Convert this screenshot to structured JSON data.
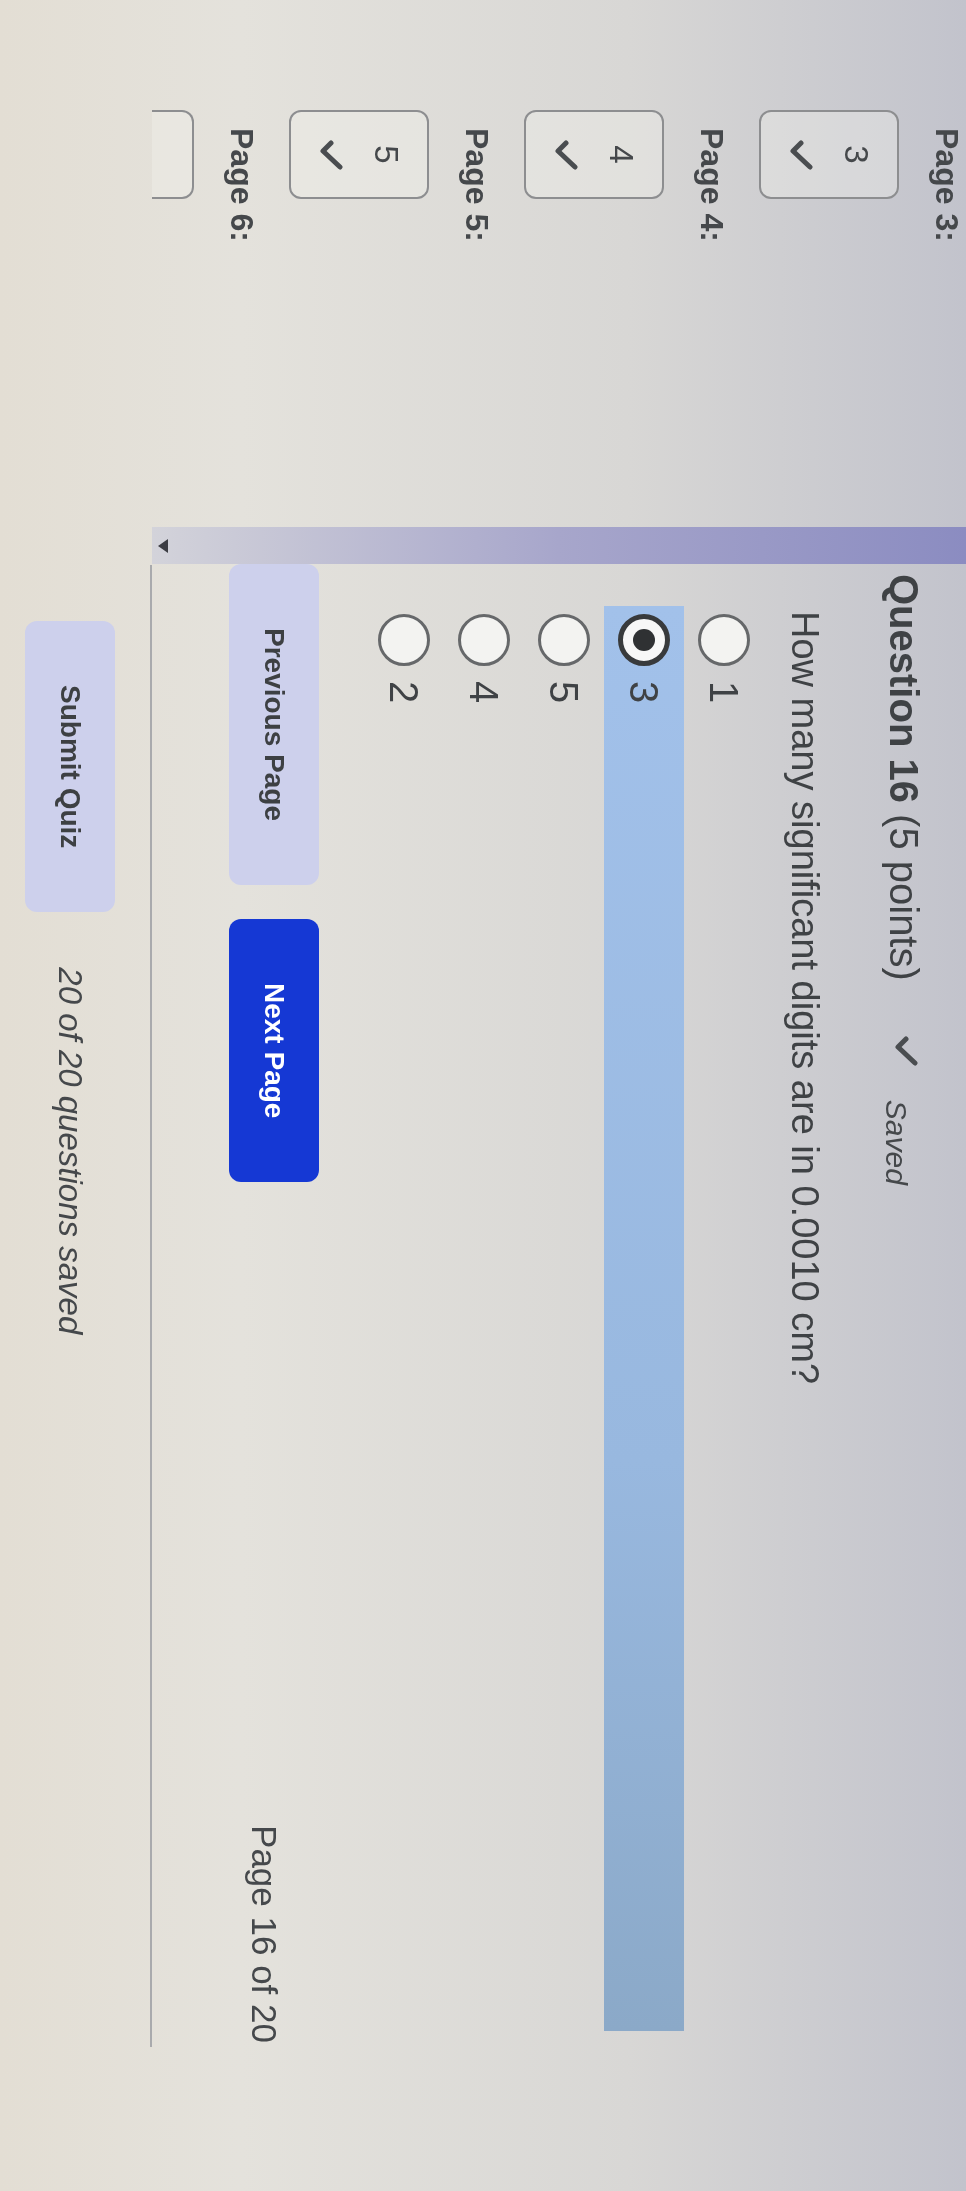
{
  "sidebar": {
    "pages": [
      {
        "label": "Page 3:",
        "questions": [
          {
            "number": "3",
            "saved": true,
            "cut_off": false
          }
        ]
      },
      {
        "label": "Page 4:",
        "questions": [
          {
            "number": "4",
            "saved": true,
            "cut_off": false
          }
        ]
      },
      {
        "label": "Page 5:",
        "questions": [
          {
            "number": "5",
            "saved": true,
            "cut_off": false
          }
        ]
      },
      {
        "label": "Page 6:",
        "questions": [
          {
            "cut_off": true
          }
        ]
      }
    ]
  },
  "question": {
    "title": "**Question 16** (5 points)",
    "saved_status": {
      "saved": true,
      "label": "Saved"
    },
    "text": "How many significant digits are in 0.0010 cm?",
    "options": [
      {
        "label": "1",
        "selected": false
      },
      {
        "label": "3",
        "selected": true
      },
      {
        "label": "5",
        "selected": false
      },
      {
        "label": "4",
        "selected": false
      },
      {
        "label": "2",
        "selected": false
      }
    ]
  },
  "navigation": {
    "buttons": [
      {
        "label": "Previous Page",
        "kind": "secondary"
      },
      {
        "label": "Next Page",
        "kind": "primary"
      }
    ],
    "page_indicator": "Page 16 of 20"
  },
  "footer": {
    "submit_button": "Submit Quiz",
    "status": "20 of 20 questions saved"
  }
}
